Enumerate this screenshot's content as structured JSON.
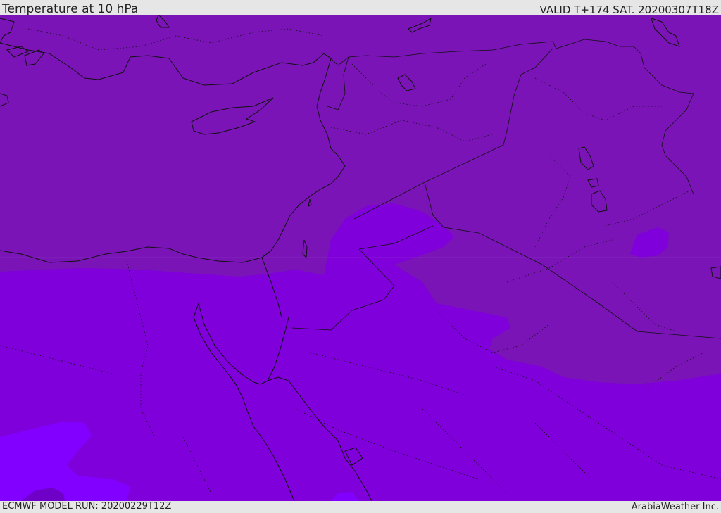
{
  "header": {
    "title": "Temperature at 10 hPa",
    "valid": "VALID T+174 SAT. 20200307T18Z"
  },
  "footer": {
    "model_run": "ECMWF MODEL RUN: 20200229T12Z",
    "credit": "ArabiaWeather Inc."
  },
  "map": {
    "region": "Eastern Mediterranean and Middle East",
    "field_colors": {
      "warmer_zone": "#7a14b6",
      "mid_zone": "#7f00da",
      "colder_zone": "#8200ff"
    },
    "coastline_color": "#111111",
    "border_style": "dotted"
  }
}
